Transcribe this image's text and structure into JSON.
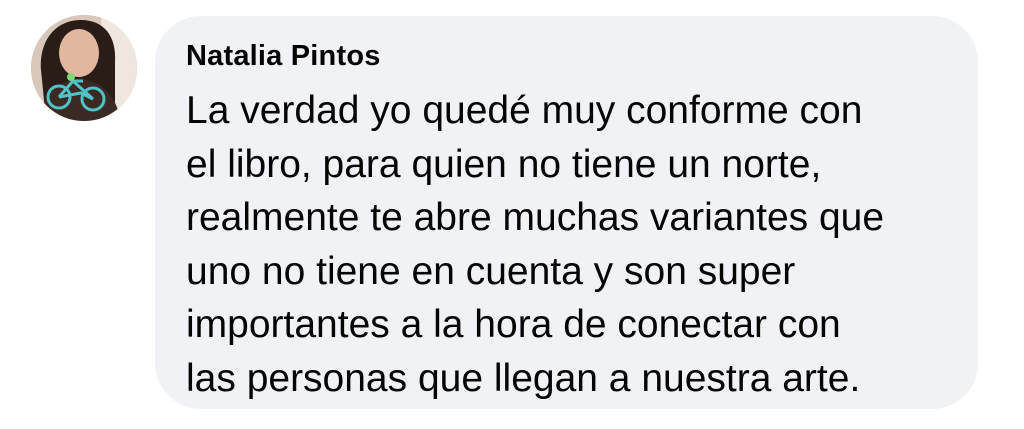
{
  "comment": {
    "author": "Natalia Pintos",
    "avatar_icon": "profile-photo-bicycle-icon",
    "text_lines": [
      "La verdad yo quedé muy conforme con",
      "el libro, para quien no tiene un norte,",
      "realmente te abre muchas variantes que",
      "uno no tiene en cuenta y son super",
      "importantes a la hora de conectar con",
      "las personas que llegan a nuestra arte."
    ]
  },
  "colors": {
    "bubble_background": "#f0f2f5",
    "text": "#050505",
    "page_background": "#ffffff"
  }
}
